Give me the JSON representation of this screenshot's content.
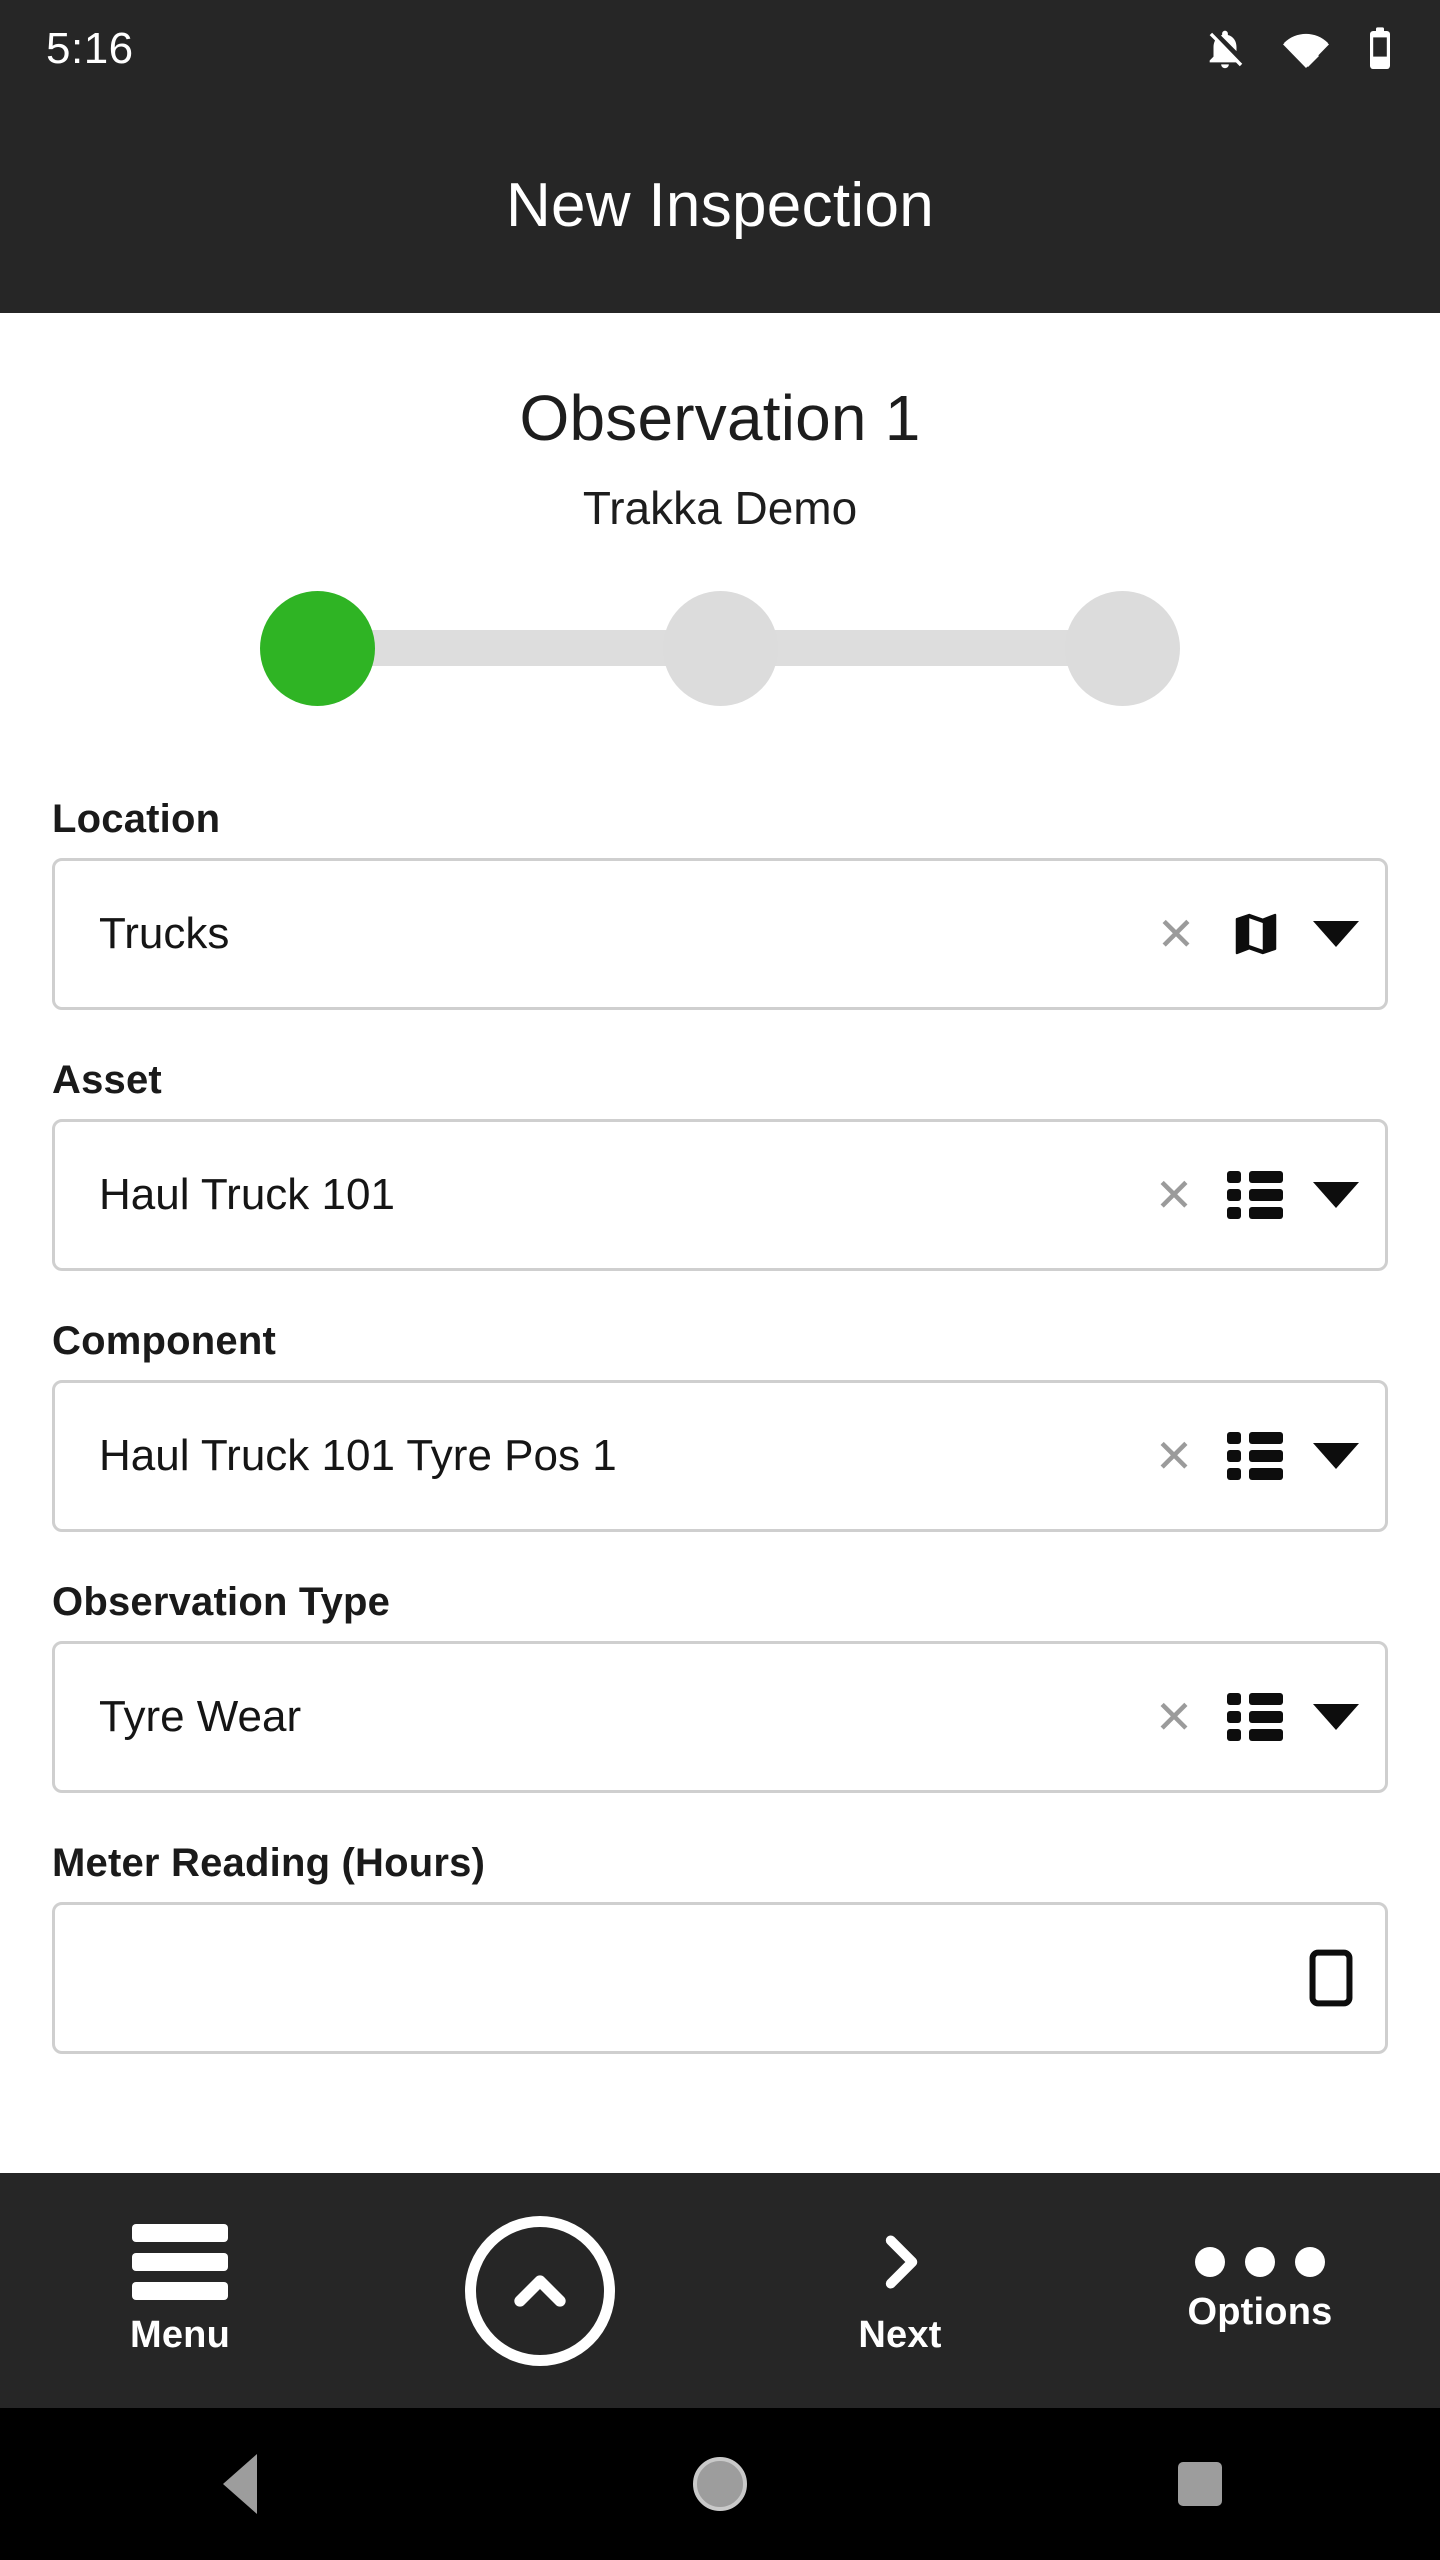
{
  "status_bar": {
    "clock": "5:16",
    "icons": [
      "notifications-off-icon",
      "wifi-icon",
      "battery-icon"
    ]
  },
  "app_bar": {
    "title": "New Inspection"
  },
  "page": {
    "heading": "Observation 1",
    "subheading": "Trakka Demo"
  },
  "stepper": {
    "total_steps": 3,
    "current_step": 1,
    "active_color": "#2fb424",
    "inactive_color": "#dcdcdc",
    "track_color": "#dddddd"
  },
  "form": {
    "fields": [
      {
        "label": "Location",
        "value": "Trucks",
        "placeholder": "",
        "clear_icon": "close-icon",
        "picker_icon": "map-icon",
        "caret_icon": "triangle-down-icon"
      },
      {
        "label": "Asset",
        "value": "Haul Truck 101",
        "placeholder": "",
        "clear_icon": "close-icon",
        "picker_icon": "list-icon",
        "caret_icon": "triangle-down-icon"
      },
      {
        "label": "Component",
        "value": "Haul Truck 101 Tyre Pos 1",
        "placeholder": "",
        "clear_icon": "close-icon",
        "picker_icon": "list-icon",
        "caret_icon": "triangle-down-icon"
      },
      {
        "label": "Observation Type",
        "value": "Tyre Wear",
        "placeholder": "",
        "clear_icon": "close-icon",
        "picker_icon": "list-icon",
        "caret_icon": "triangle-down-icon"
      },
      {
        "label": "Meter Reading (Hours)",
        "value": "",
        "placeholder": "",
        "clear_icon": "",
        "picker_icon": "keypad-icon",
        "caret_icon": ""
      }
    ]
  },
  "toolbar": {
    "menu_label": "Menu",
    "menu_icon": "hamburger-icon",
    "expand_icon": "chevron-up-circle-icon",
    "next_label": "Next",
    "next_icon": "chevron-right-icon",
    "options_label": "Options",
    "options_icon": "ellipsis-icon"
  },
  "nav_bar": {
    "back": "back-triangle-icon",
    "home": "home-circle-icon",
    "recents": "recents-square-icon"
  }
}
